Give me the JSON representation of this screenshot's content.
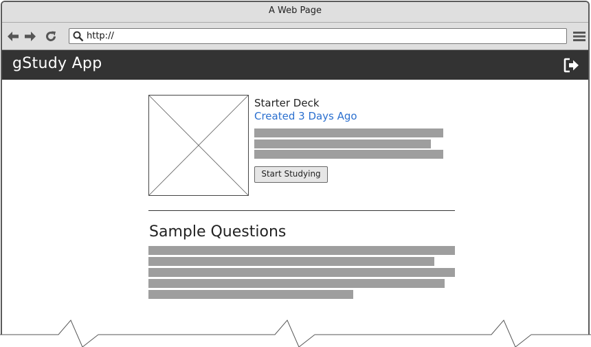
{
  "browser": {
    "window_title": "A Web Page",
    "url": "http://"
  },
  "app": {
    "title": "gStudy App"
  },
  "deck": {
    "title": "Starter Deck",
    "created": "Created 3 Days Ago",
    "start_label": "Start Studying"
  },
  "sample": {
    "title": "Sample Questions"
  },
  "icons": {
    "back": "arrow-left-icon",
    "forward": "arrow-right-icon",
    "reload": "reload-icon",
    "search": "search-icon",
    "menu": "hamburger-menu-icon",
    "logout": "logout-icon",
    "image": "image-placeholder-icon"
  },
  "colors": {
    "appbar": "#333333",
    "link": "#2a6fcf",
    "text_placeholder": "#9e9e9e"
  }
}
